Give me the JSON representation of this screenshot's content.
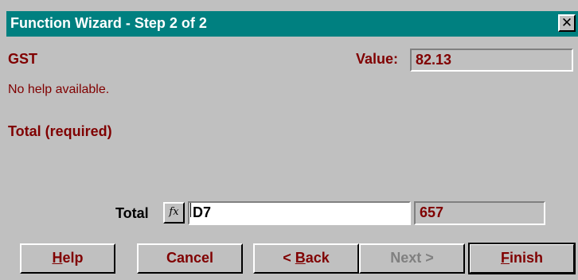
{
  "window": {
    "title": "Function Wizard - Step 2 of 2",
    "close_glyph": "✕"
  },
  "function": {
    "name": "GST",
    "value_label": "Value:",
    "value": "82.13",
    "help_text": "No help available.",
    "argument_heading": "Total (required)"
  },
  "argument": {
    "label": "Total",
    "fx_icon": "fx-icon",
    "input_value": "D7",
    "result": "657"
  },
  "buttons": {
    "help": {
      "label_pre": "",
      "label_ul": "H",
      "label_post": "elp"
    },
    "cancel": {
      "label": "Cancel"
    },
    "back": {
      "label_pre": "< ",
      "label_ul": "B",
      "label_post": "ack"
    },
    "next": {
      "label": "Next >"
    },
    "finish": {
      "label_pre": "",
      "label_ul": "F",
      "label_post": "inish"
    }
  },
  "colors": {
    "titlebar": "#008080",
    "text_accent": "#800000",
    "dialog_bg": "#c0c0c0",
    "disabled": "#808080"
  }
}
